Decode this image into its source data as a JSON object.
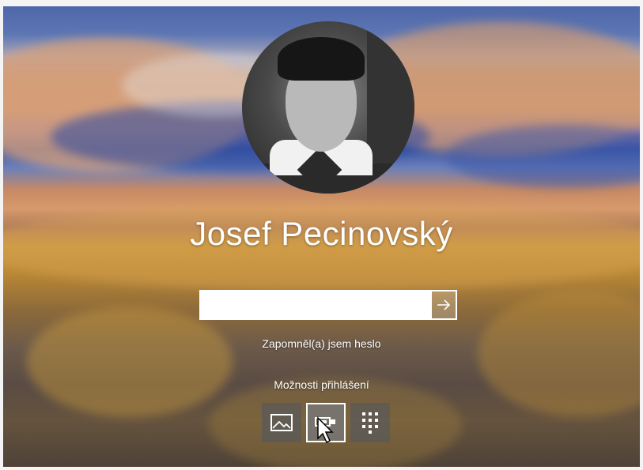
{
  "user": {
    "name": "Josef Pecinovský"
  },
  "password_field": {
    "value": "",
    "placeholder": ""
  },
  "links": {
    "forgot_password": "Zapomněl(a) jsem heslo",
    "sign_in_options": "Možnosti přihlášení"
  },
  "sign_in_options": [
    {
      "icon": "picture-password-icon"
    },
    {
      "icon": "security-key-icon",
      "selected": true
    },
    {
      "icon": "pin-keypad-icon"
    }
  ],
  "colors": {
    "text": "#ffffff",
    "input_background": "#ffffff",
    "option_tile": "#5a5a5a"
  }
}
